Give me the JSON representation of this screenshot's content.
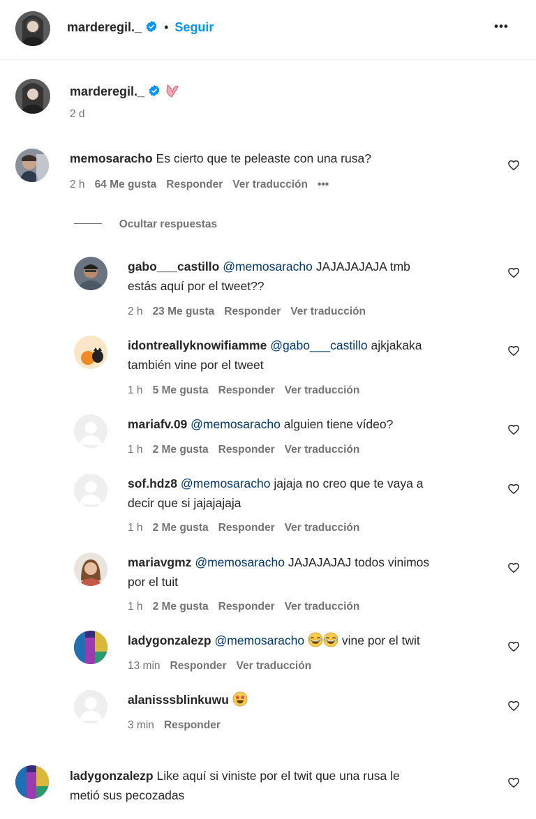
{
  "header": {
    "username": "marderegil._",
    "separator": "•",
    "follow_label": "Seguir",
    "more_label": "•••"
  },
  "post": {
    "username": "marderegil._",
    "time": "2 d"
  },
  "comment": {
    "username": "memosaracho",
    "text": "Es cierto que te peleaste con una rusa?",
    "time": "2 h",
    "likes": "64 Me gusta",
    "reply": "Responder",
    "translate": "Ver traducción",
    "more": "•••"
  },
  "hide_replies": "Ocultar respuestas",
  "replies": [
    {
      "username": "gabo___castillo",
      "mention": "@memosaracho",
      "line1": "JAJAJAJAJA tmb",
      "line2": "estás aquí por el tweet??",
      "time": "2 h",
      "likes": "23 Me gusta",
      "reply": "Responder",
      "translate": "Ver traducción"
    },
    {
      "username": "idontreallyknowifiamme",
      "mention": "@gabo___castillo",
      "line1": "ajkjakaka",
      "line2": "también vine por el tweet",
      "time": "1 h",
      "likes": "5 Me gusta",
      "reply": "Responder",
      "translate": "Ver traducción"
    },
    {
      "username": "mariafv.09",
      "mention": "@memosaracho",
      "line1": "alguien tiene vídeo?",
      "time": "1 h",
      "likes": "2 Me gusta",
      "reply": "Responder",
      "translate": "Ver traducción"
    },
    {
      "username": "sof.hdz8",
      "mention": "@memosaracho",
      "line1": "jajaja no creo que te vaya a",
      "line2": "decir que si jajajajaja",
      "time": "1 h",
      "likes": "2 Me gusta",
      "reply": "Responder",
      "translate": "Ver traducción"
    },
    {
      "username": "mariavgmz",
      "mention": "@memosaracho",
      "line1": "JAJAJAJAJ todos vinimos",
      "line2": "por el tuit",
      "time": "1 h",
      "likes": "2 Me gusta",
      "reply": "Responder",
      "translate": "Ver traducción"
    },
    {
      "username": "ladygonzalezp",
      "mention": "@memosaracho",
      "line1": "vine por el twit",
      "time": "13 min",
      "reply": "Responder",
      "translate": "Ver traducción"
    },
    {
      "username": "alanisssblinkuwu",
      "time": "3 min",
      "reply": "Responder"
    }
  ],
  "last_comment": {
    "username": "ladygonzalezp",
    "line1": "Like aquí si viniste por el twit que una rusa le",
    "line2": "metió sus pecozadas"
  },
  "colors": {
    "link": "#0095f6",
    "mention": "#00376b",
    "meta": "#737373",
    "verified": "#0095f6"
  },
  "icons": {
    "verified": "verified-badge-icon",
    "heart": "heart-outline-icon",
    "more": "more-horizontal-icon"
  }
}
